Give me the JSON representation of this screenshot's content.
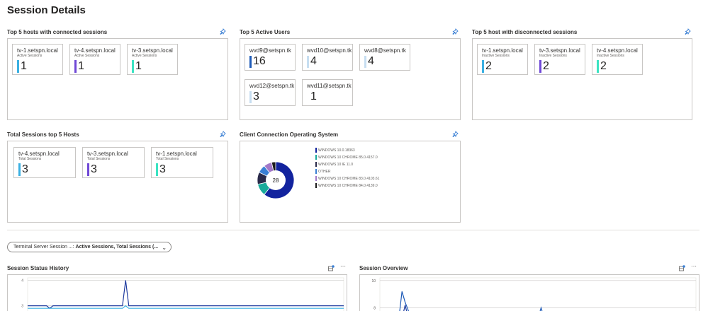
{
  "page": {
    "title": "Session Details"
  },
  "tiles": {
    "connected": {
      "title": "Top 5 hosts with connected sessions",
      "cards": [
        {
          "host": "tv-1.setspn.local",
          "sub": "Active Sessions",
          "value": "1",
          "color": "#3ab0e2"
        },
        {
          "host": "tv-4.setspn.local",
          "sub": "Active Sessions",
          "value": "1",
          "color": "#6f48d6"
        },
        {
          "host": "tv-3.setspn.local",
          "sub": "Active Sessions",
          "value": "1",
          "color": "#3be3c2"
        }
      ]
    },
    "active_users": {
      "title": "Top 5 Active Users",
      "cards": [
        {
          "host": "wvd9@setspn.tk",
          "value": "16",
          "color": "#1e5bb8"
        },
        {
          "host": "wvd10@setspn.tk",
          "value": "4",
          "color": "#c7def1"
        },
        {
          "host": "wvd8@setspn.tk",
          "value": "4",
          "color": "#c7def1"
        },
        {
          "host": "wvd12@setspn.tk",
          "value": "3",
          "color": "#c7def1"
        },
        {
          "host": "wvd11@setspn.tk",
          "value": "1",
          "color": "#ffffff"
        }
      ]
    },
    "disconnected": {
      "title": "Top 5 host with disconnected sessions",
      "cards": [
        {
          "host": "tv-1.setspn.local",
          "sub": "Inactive Sessions",
          "value": "2",
          "color": "#3ab0e2"
        },
        {
          "host": "tv-3.setspn.local",
          "sub": "Inactive Sessions",
          "value": "2",
          "color": "#6f48d6"
        },
        {
          "host": "tv-4.setspn.local",
          "sub": "Inactive Sessions",
          "value": "2",
          "color": "#3be3c2"
        }
      ]
    },
    "total": {
      "title": "Total Sessions top 5 Hosts",
      "cards": [
        {
          "host": "tv-4.setspn.local",
          "sub": "Total Sessions",
          "value": "3",
          "color": "#3ab0e2"
        },
        {
          "host": "tv-3.setspn.local",
          "sub": "Total Sessions",
          "value": "3",
          "color": "#6f48d6"
        },
        {
          "host": "tv-1.setspn.local",
          "sub": "Total Sessions",
          "value": "3",
          "color": "#3be3c2"
        }
      ]
    },
    "os": {
      "title": "Client Connection Operating System",
      "center": "28"
    },
    "status_history": {
      "title": "Session Status History"
    },
    "overview": {
      "title": "Session Overview"
    }
  },
  "filter": {
    "label": "Terminal Server Session ...:",
    "value": "Active Sessions, Total Sessions (..."
  },
  "chart_data": [
    {
      "type": "pie",
      "title": "Client Connection Operating System",
      "center_label": "28",
      "legend": "right",
      "categories": [
        "WINDOWS 10.0.18363",
        "WINDOWS 10 CHROME 85.0.4157.0",
        "WINDOWS 10 IE 11.0",
        "OTHER",
        "WINDOWS 10 CHROME 83.0.4103.61",
        "WINDOWS 10 CHROME 84.0.4139.0"
      ],
      "values": [
        17,
        3,
        3,
        2,
        2,
        1
      ],
      "colors": [
        "#12239e",
        "#1aab9b",
        "#2a2a4a",
        "#3a7fd4",
        "#a278c8",
        "#1c1c1c"
      ]
    },
    {
      "type": "line",
      "title": "Session Status History",
      "yticks": [
        "4",
        "3"
      ],
      "ylim": [
        2.6,
        4.1
      ],
      "series": [
        {
          "color": "#1e3a9e",
          "x": [
            0,
            6,
            7,
            8,
            30,
            31,
            32,
            33,
            100
          ],
          "y": [
            3,
            3,
            2.9,
            3,
            3,
            4,
            3,
            3,
            3
          ]
        },
        {
          "color": "#3ab0e2",
          "x": [
            0,
            30,
            31,
            32,
            33,
            100
          ],
          "y": [
            2.9,
            2.9,
            3.0,
            2.9,
            2.9,
            2.9
          ]
        }
      ]
    },
    {
      "type": "line",
      "title": "Session Overview",
      "yticks": [
        "10",
        "8"
      ],
      "ylim": [
        7.4,
        10.2
      ],
      "series": [
        {
          "color": "#1e5bb8",
          "x": [
            0,
            6,
            7,
            8,
            9,
            10,
            28,
            29,
            30,
            50,
            51,
            52,
            60,
            61,
            62,
            100
          ],
          "y": [
            7.2,
            7.2,
            9.2,
            8.4,
            7.8,
            7.2,
            7.2,
            7.6,
            7.2,
            7.2,
            8.0,
            7.2,
            7.2,
            7.6,
            7.2,
            7.2
          ]
        },
        {
          "color": "#1e3a9e",
          "x": [
            0,
            7,
            8,
            9,
            28,
            29,
            30,
            100
          ],
          "y": [
            7.2,
            7.2,
            8.2,
            7.2,
            7.2,
            7.5,
            7.2,
            7.2
          ]
        }
      ]
    }
  ]
}
